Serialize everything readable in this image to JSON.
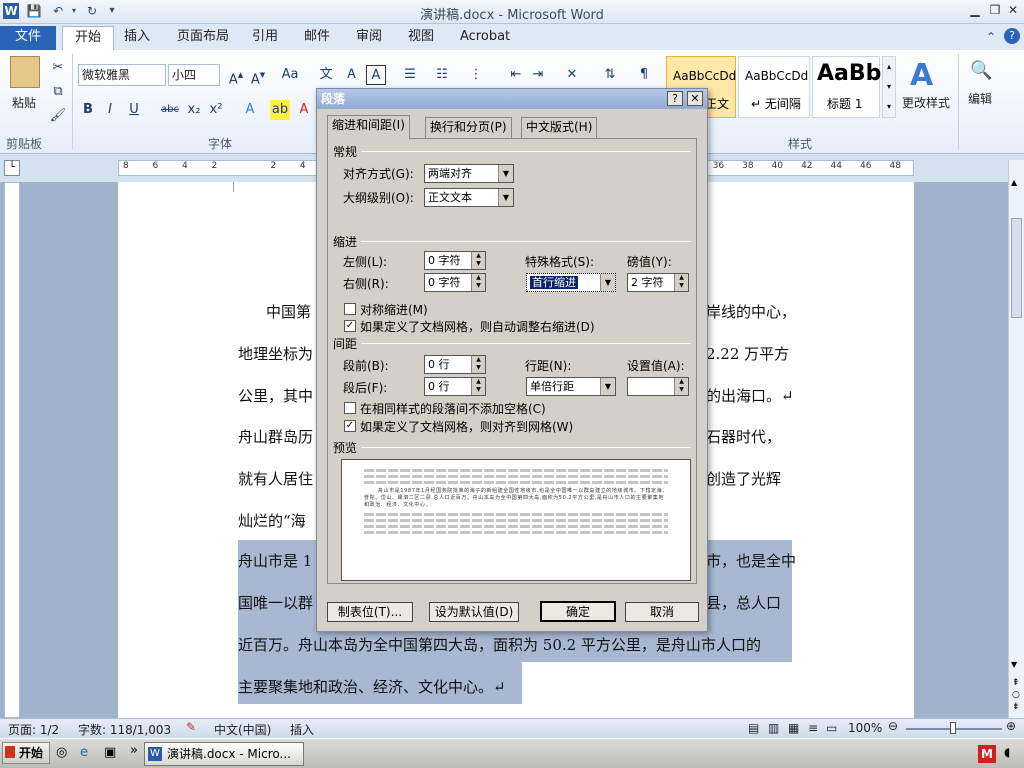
{
  "window": {
    "title": "演讲稿.docx - Microsoft Word"
  },
  "ribbon_tabs": [
    "文件",
    "开始",
    "插入",
    "页面布局",
    "引用",
    "邮件",
    "审阅",
    "视图",
    "Acrobat"
  ],
  "clipboard": {
    "paste_label": "粘贴",
    "group_label": "剪贴板"
  },
  "font": {
    "name": "微软雅黑",
    "size": "小四",
    "group_label": "字体"
  },
  "styles": {
    "group_label": "样式",
    "items": [
      {
        "preview": "AaBbCcDd",
        "name": "正文"
      },
      {
        "preview": "AaBbCcDd",
        "name": "↵ 无间隔"
      },
      {
        "preview": "AaBb",
        "name": "标题 1"
      }
    ],
    "change_styles": "更改样式"
  },
  "editing": {
    "label": "编辑"
  },
  "ruler_ticks": [
    "8",
    "6",
    "4",
    "2",
    "",
    "2",
    "4",
    "",
    "",
    "",
    "",
    "",
    "",
    "",
    "",
    "",
    "",
    "",
    "32",
    "34",
    "36",
    "38",
    "40",
    "42",
    "44",
    "46",
    "48"
  ],
  "document": {
    "lines": [
      {
        "a": "中国第",
        "b": "岸线的中心，"
      },
      {
        "a": "地理坐标为",
        "b": "2.22 万平方"
      },
      {
        "a": "公里，其中",
        "b": "的出海口。↵"
      },
      {
        "a": "舟山群岛历",
        "b": "石器时代，"
      },
      {
        "a": "就有人居住",
        "b": "创造了光辉"
      },
      {
        "a": "灿烂的“海",
        "b": ""
      },
      {
        "a": "舟山市是 1",
        "b": "市，也是全中"
      },
      {
        "a": "国唯一以群",
        "b": "县，总人口"
      },
      {
        "a": "近百万。舟山本岛为全中国第四大岛，面积为 50.2 平方公里，是舟山市人口的",
        "b": ""
      },
      {
        "a": "主要聚集地和政治、经济、文化中心。↵",
        "b": ""
      }
    ]
  },
  "status": {
    "page": "页面: 1/2",
    "words": "字数: 118/1,003",
    "lang": "中文(中国)",
    "mode": "插入",
    "zoom": "100%"
  },
  "taskbar": {
    "start": "开始",
    "task": "演讲稿.docx - Micro..."
  },
  "dialog": {
    "title": "段落",
    "tabs": [
      "缩进和间距(I)",
      "换行和分页(P)",
      "中文版式(H)"
    ],
    "general": {
      "heading": "常规",
      "align_label": "对齐方式(G):",
      "align_value": "两端对齐",
      "outline_label": "大纲级别(O):",
      "outline_value": "正文文本"
    },
    "indent": {
      "heading": "缩进",
      "left_label": "左侧(L):",
      "left_value": "0 字符",
      "right_label": "右侧(R):",
      "right_value": "0 字符",
      "special_label": "特殊格式(S):",
      "special_value": "首行缩进",
      "by_label": "磅值(Y):",
      "by_value": "2 字符",
      "mirror_label": "对称缩进(M)",
      "auto_label": "如果定义了文档网格，则自动调整右缩进(D)"
    },
    "spacing": {
      "heading": "间距",
      "before_label": "段前(B):",
      "before_value": "0 行",
      "after_label": "段后(F):",
      "after_value": "0 行",
      "line_label": "行距(N):",
      "line_value": "单倍行距",
      "at_label": "设置值(A):",
      "at_value": "",
      "nospace_label": "在相同样式的段落间不添加空格(C)",
      "grid_label": "如果定义了文档网格，则对齐到网格(W)"
    },
    "preview": {
      "heading": "预览",
      "text": "舟山市是1987年1月经国务院批准的海子的新组建全国性地级市,也是全中国唯一以群岛建立的地级城市。下辖定海、普陀、岱山、嵊泗二区二县,总人口近百万。舟山本岛为全中国第四大岛,面积为50.2平方公里,是舟山市人口的主要聚集地和政治、经济、文化中心。"
    },
    "buttons": {
      "tabs": "制表位(T)...",
      "default": "设为默认值(D)",
      "ok": "确定",
      "cancel": "取消"
    }
  }
}
